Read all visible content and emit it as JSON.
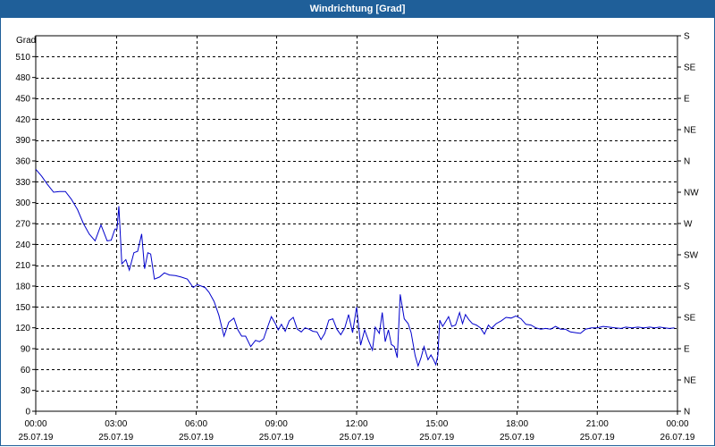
{
  "window": {
    "title": "Windrichtung [Grad]"
  },
  "chart_data": {
    "type": "line",
    "ylabel": "Grad",
    "ylim": [
      0,
      540
    ],
    "y_ticks": [
      0,
      30,
      60,
      90,
      120,
      150,
      180,
      210,
      240,
      270,
      300,
      330,
      360,
      390,
      420,
      450,
      480,
      510
    ],
    "xlim": [
      0,
      24
    ],
    "x_ticks": [
      {
        "x": 0,
        "time": "00:00",
        "date": "25.07.19"
      },
      {
        "x": 3,
        "time": "03:00",
        "date": "25.07.19"
      },
      {
        "x": 6,
        "time": "06:00",
        "date": "25.07.19"
      },
      {
        "x": 9,
        "time": "09:00",
        "date": "25.07.19"
      },
      {
        "x": 12,
        "time": "12:00",
        "date": "25.07.19"
      },
      {
        "x": 15,
        "time": "15:00",
        "date": "25.07.19"
      },
      {
        "x": 18,
        "time": "18:00",
        "date": "25.07.19"
      },
      {
        "x": 21,
        "time": "21:00",
        "date": "25.07.19"
      },
      {
        "x": 24,
        "time": "00:00",
        "date": "26.07.19"
      }
    ],
    "right_axis": [
      {
        "deg": 0,
        "label": "N"
      },
      {
        "deg": 45,
        "label": "NE"
      },
      {
        "deg": 90,
        "label": "E"
      },
      {
        "deg": 135,
        "label": "SE"
      },
      {
        "deg": 180,
        "label": "S"
      },
      {
        "deg": 225,
        "label": "SW"
      },
      {
        "deg": 270,
        "label": "W"
      },
      {
        "deg": 315,
        "label": "NW"
      },
      {
        "deg": 360,
        "label": "N"
      },
      {
        "deg": 405,
        "label": "NE"
      },
      {
        "deg": 450,
        "label": "E"
      },
      {
        "deg": 495,
        "label": "SE"
      },
      {
        "deg": 540,
        "label": "S"
      }
    ],
    "grid": true,
    "series": [
      {
        "color": "#0000cc",
        "x": [
          0.0,
          0.22,
          0.44,
          0.67,
          0.89,
          1.11,
          1.33,
          1.56,
          1.78,
          2.0,
          2.22,
          2.44,
          2.67,
          2.82,
          2.96,
          3.04,
          3.11,
          3.22,
          3.37,
          3.5,
          3.67,
          3.81,
          3.96,
          4.07,
          4.19,
          4.3,
          4.44,
          4.63,
          4.81,
          5.0,
          5.22,
          5.44,
          5.67,
          5.89,
          6.04,
          6.19,
          6.33,
          6.48,
          6.67,
          6.85,
          7.04,
          7.22,
          7.41,
          7.56,
          7.7,
          7.85,
          8.04,
          8.22,
          8.37,
          8.52,
          8.67,
          8.81,
          8.96,
          9.07,
          9.19,
          9.33,
          9.48,
          9.63,
          9.78,
          9.93,
          10.07,
          10.22,
          10.37,
          10.52,
          10.67,
          10.81,
          10.96,
          11.11,
          11.26,
          11.41,
          11.56,
          11.7,
          11.85,
          12.0,
          12.15,
          12.3,
          12.44,
          12.59,
          12.7,
          12.85,
          12.96,
          13.07,
          13.19,
          13.3,
          13.41,
          13.52,
          13.63,
          13.78,
          13.93,
          14.04,
          14.19,
          14.3,
          14.41,
          14.52,
          14.67,
          14.78,
          14.89,
          14.96,
          15.04,
          15.11,
          15.22,
          15.33,
          15.44,
          15.56,
          15.7,
          15.85,
          15.96,
          16.07,
          16.19,
          16.33,
          16.48,
          16.63,
          16.78,
          16.93,
          17.04,
          17.22,
          17.41,
          17.59,
          17.78,
          17.96,
          18.15,
          18.33,
          18.52,
          18.7,
          18.89,
          19.07,
          19.26,
          19.44,
          19.63,
          19.81,
          20.0,
          20.19,
          20.37,
          20.56,
          20.78,
          21.0,
          21.22,
          21.44,
          21.67,
          21.89,
          22.07,
          22.3,
          22.52,
          22.74,
          22.96,
          23.15,
          23.33,
          23.52,
          23.7,
          23.89
        ],
        "y": [
          348,
          338,
          326,
          315,
          316,
          316,
          305,
          290,
          270,
          255,
          245,
          268,
          245,
          246,
          262,
          262,
          295,
          212,
          218,
          203,
          228,
          230,
          255,
          205,
          228,
          226,
          190,
          193,
          199,
          196,
          195,
          193,
          190,
          178,
          182,
          180,
          178,
          171,
          158,
          138,
          108,
          128,
          134,
          117,
          108,
          108,
          93,
          102,
          100,
          104,
          121,
          136,
          126,
          117,
          125,
          115,
          130,
          135,
          118,
          114,
          120,
          118,
          115,
          114,
          103,
          112,
          131,
          133,
          118,
          110,
          120,
          139,
          113,
          150,
          95,
          117,
          102,
          88,
          121,
          112,
          142,
          100,
          117,
          96,
          93,
          77,
          168,
          133,
          126,
          113,
          80,
          65,
          77,
          93,
          74,
          81,
          73,
          67,
          80,
          131,
          122,
          129,
          136,
          122,
          124,
          142,
          126,
          139,
          132,
          126,
          124,
          120,
          111,
          124,
          119,
          126,
          130,
          135,
          134,
          137,
          133,
          125,
          124,
          120,
          118,
          119,
          118,
          122,
          118,
          118,
          114,
          113,
          112,
          118,
          120,
          120,
          122,
          121,
          120,
          119,
          121,
          120,
          121,
          120,
          121,
          120,
          121,
          120,
          119,
          120
        ]
      }
    ]
  }
}
